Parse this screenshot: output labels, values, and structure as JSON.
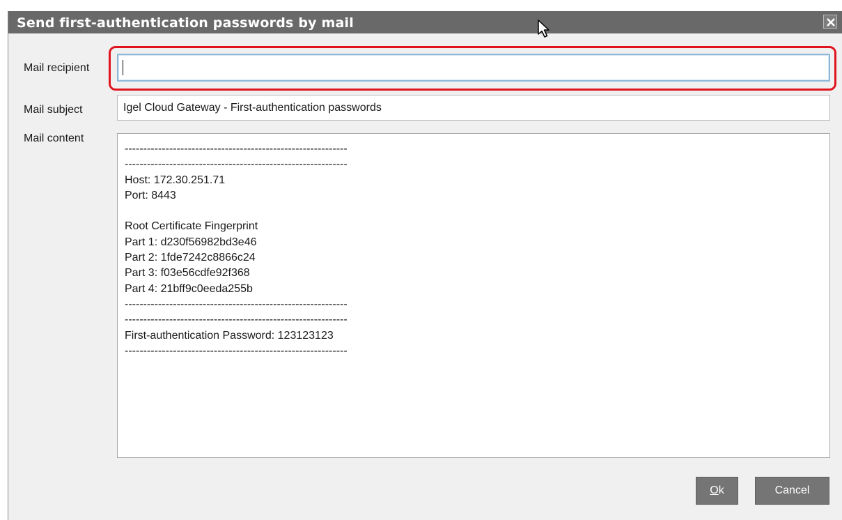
{
  "dialog": {
    "title": "Send first-authentication passwords by mail"
  },
  "form": {
    "recipient_label": "Mail recipient",
    "recipient_value": "",
    "subject_label": "Mail subject",
    "subject_value": "Igel Cloud Gateway - First-authentication passwords",
    "content_label": "Mail content",
    "content_lines": [
      "------------------------------------------------------------",
      "------------------------------------------------------------",
      "Host: 172.30.251.71",
      "Port: 8443",
      "",
      "Root Certificate Fingerprint",
      "Part 1: d230f56982bd3e46",
      "Part 2: 1fde7242c8866c24",
      "Part 3: f03e56cdfe92f368",
      "Part 4: 21bff9c0eeda255b",
      "------------------------------------------------------------",
      "------------------------------------------------------------",
      "First-authentication Password: 123123123",
      "------------------------------------------------------------"
    ]
  },
  "buttons": {
    "ok_mnemonic": "O",
    "ok_rest": "k",
    "cancel_label": "Cancel"
  },
  "icons": {
    "close": "close-icon",
    "cursor": "mouse-pointer-icon"
  },
  "colors": {
    "titlebar": "#696969",
    "highlight": "#e0141e",
    "button": "#757575"
  }
}
